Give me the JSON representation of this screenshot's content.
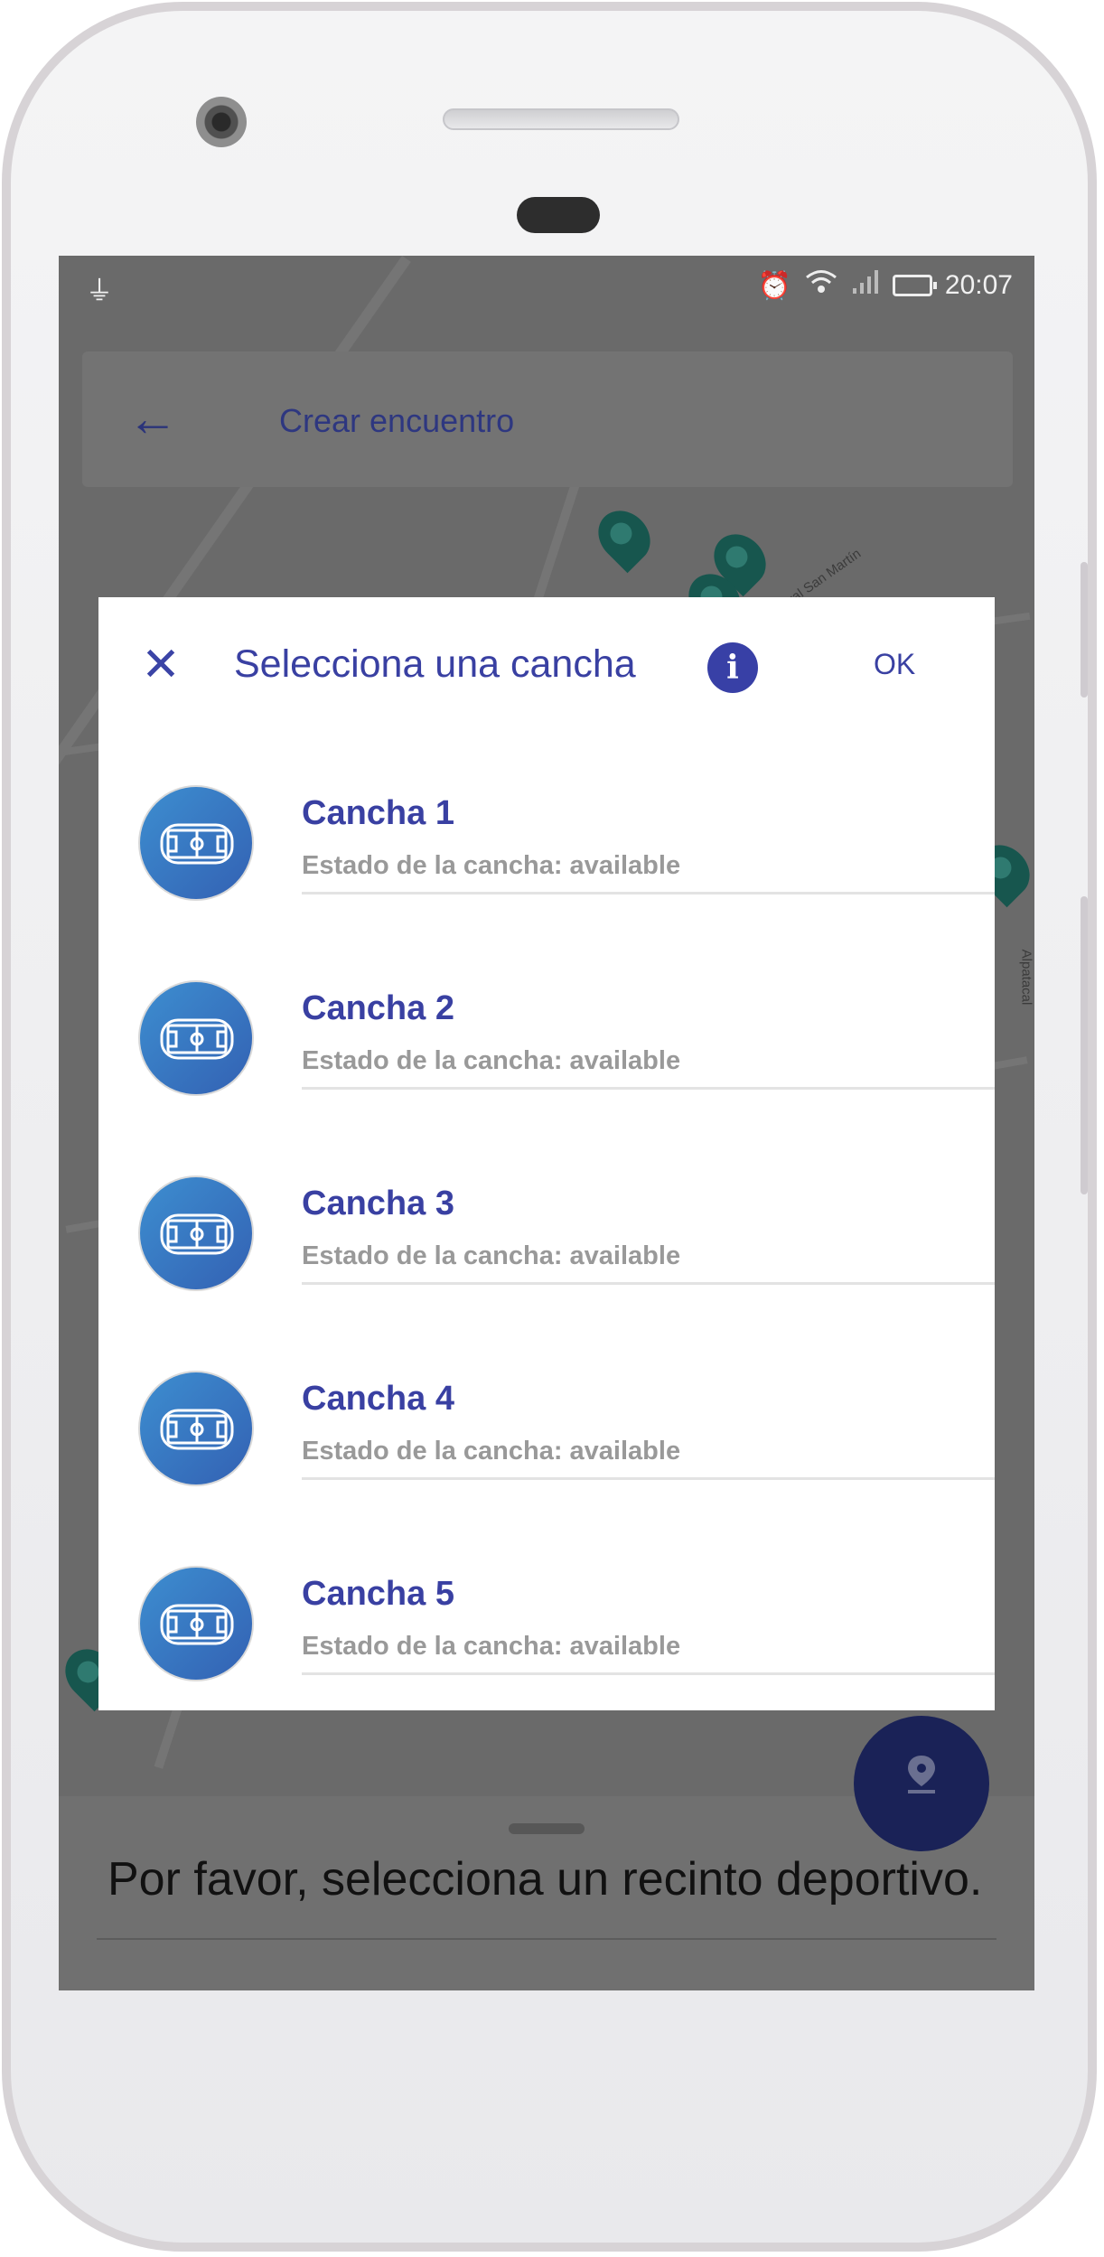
{
  "status_bar": {
    "time": "20:07"
  },
  "app_bar": {
    "title": "Crear encuentro"
  },
  "map": {
    "street_labels": [
      "Gral San Martín",
      "Alpatacal"
    ]
  },
  "dialog": {
    "title": "Selecciona una cancha",
    "ok_label": "OK",
    "items": [
      {
        "title": "Cancha 1",
        "subtitle": "Estado de la cancha: available"
      },
      {
        "title": "Cancha 2",
        "subtitle": "Estado de la cancha: available"
      },
      {
        "title": "Cancha 3",
        "subtitle": "Estado de la cancha: available"
      },
      {
        "title": "Cancha 4",
        "subtitle": "Estado de la cancha: available"
      },
      {
        "title": "Cancha 5",
        "subtitle": "Estado de la cancha: available"
      }
    ]
  },
  "bottom_sheet": {
    "message": "Por favor, selecciona un recinto deportivo."
  },
  "colors": {
    "accent": "#3940a2",
    "fab": "#1a2257",
    "subtitle": "#999999"
  },
  "icons": [
    "usb-icon",
    "alarm-icon",
    "wifi-icon",
    "signal-icon",
    "battery-icon",
    "back-arrow-icon",
    "close-icon",
    "info-icon",
    "soccer-field-icon",
    "location-pin-icon"
  ]
}
